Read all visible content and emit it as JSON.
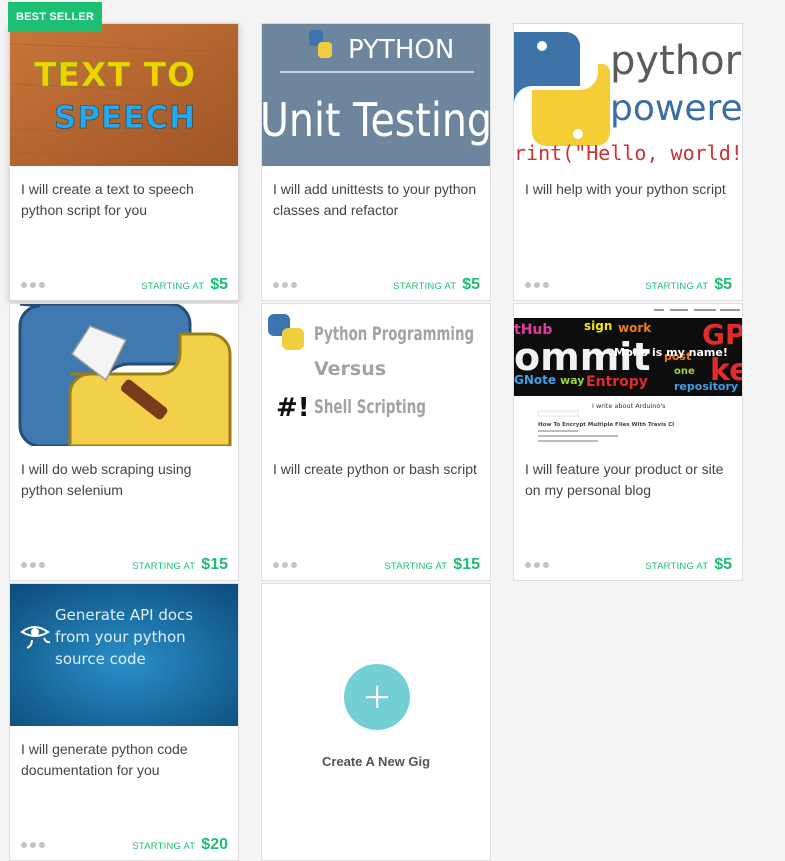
{
  "badge": {
    "label": "BEST SELLER"
  },
  "starting_label": "STARTING AT",
  "colors": {
    "accent": "#1dbf73",
    "plus": "#74cfd5"
  },
  "thumbs": {
    "tts": {
      "line1": "TEXT TO",
      "line2": "SPEECH"
    },
    "unit": {
      "small": "PYTHON",
      "big": "Unit Testing"
    },
    "powered": {
      "word1": "pythor",
      "word2": "powerec",
      "code": "rint(\"Hello, world!\""
    },
    "shell": {
      "l1": "Python Programming",
      "l2": "Versus",
      "l3": "Shell Scripting",
      "hash": "#!"
    },
    "blog": {
      "headline": "I write about Arduino's",
      "post": "How To Encrypt Multiple Files With Travis CI",
      "name": "Mpho is my name!"
    },
    "api": {
      "l1": "Generate API docs",
      "l2": "from your python",
      "l3": "source code"
    }
  },
  "gigs": [
    {
      "title": "I will create a text to speech python script for you",
      "price": "$5"
    },
    {
      "title": "I will add unittests to your python classes and refactor",
      "price": "$5"
    },
    {
      "title": "I will help with your python script",
      "price": "$5"
    },
    {
      "title": "I will do web scraping using python selenium",
      "price": "$15"
    },
    {
      "title": "I will create python or bash script",
      "price": "$15"
    },
    {
      "title": "I will feature your product or site on my personal blog",
      "price": "$5"
    },
    {
      "title": "I will generate python code documentation for you",
      "price": "$20"
    }
  ],
  "new_gig": {
    "label": "Create A New Gig",
    "plus": "+"
  }
}
